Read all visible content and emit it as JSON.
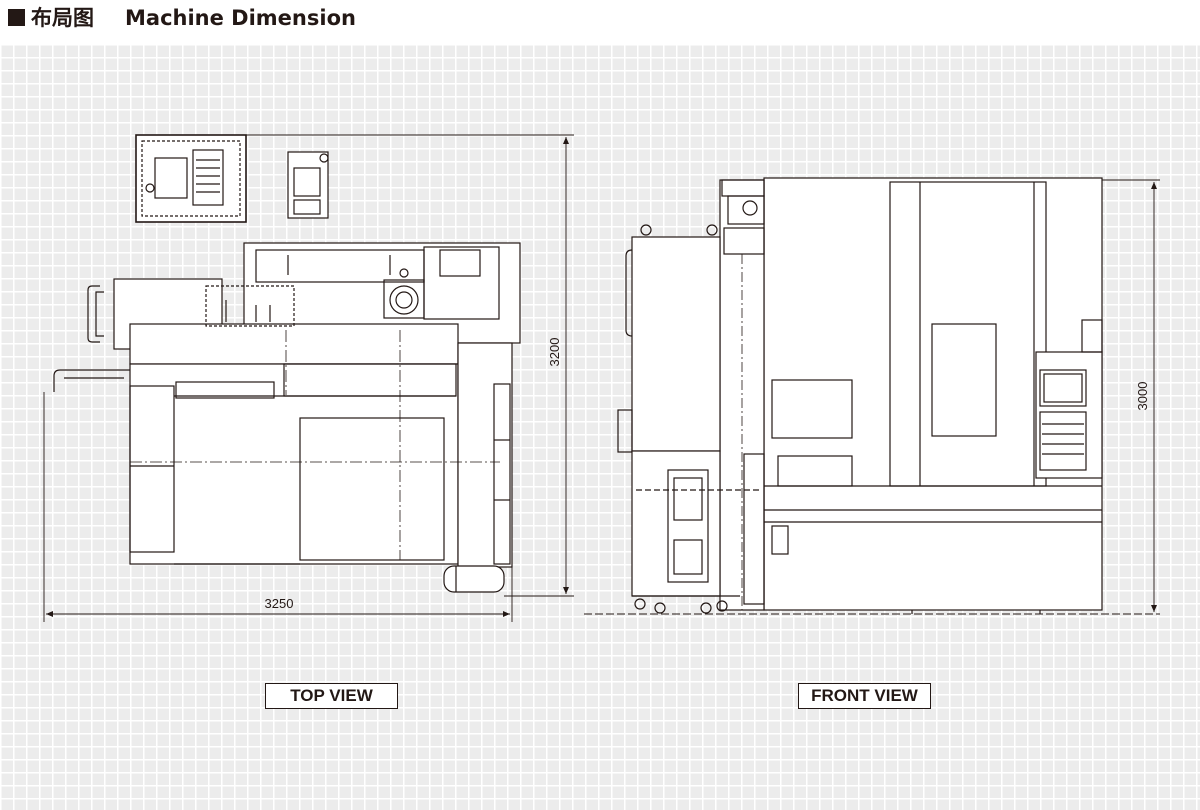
{
  "header": {
    "title_cn": "布局图",
    "title_en": "Machine Dimension"
  },
  "top_view": {
    "label": "TOP VIEW",
    "width_dim": "3250",
    "depth_dim": "3200"
  },
  "front_view": {
    "label": "FRONT VIEW",
    "height_dim": "3000"
  },
  "colors": {
    "line": "#231815",
    "grid_bg": "#ececec",
    "grid_line": "#ffffff"
  }
}
